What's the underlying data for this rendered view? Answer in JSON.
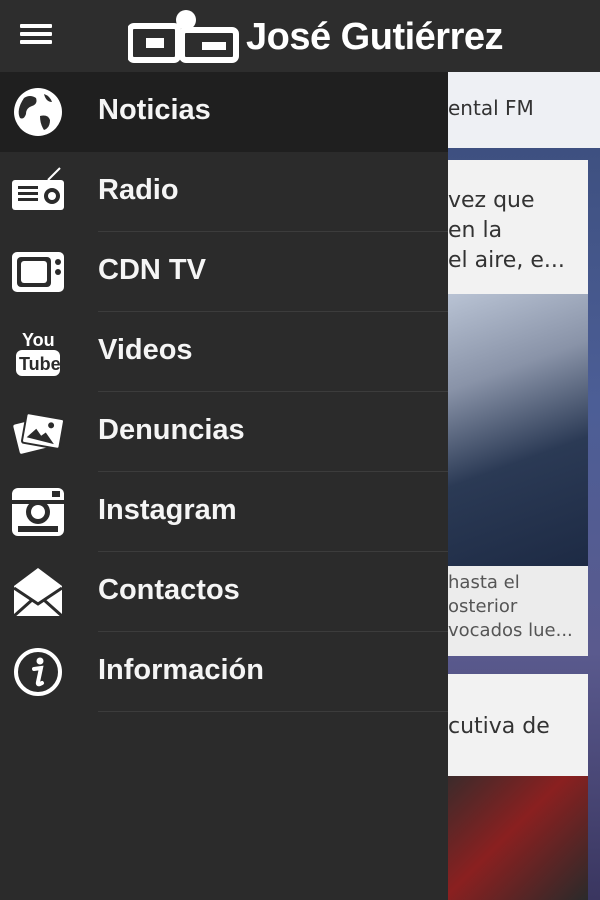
{
  "header": {
    "brand_title": "José Gutiérrez",
    "menu_icon": "hamburger-menu-icon",
    "logo_icon": "jg-logo-icon"
  },
  "drawer": {
    "items": [
      {
        "label": "Noticias",
        "icon": "globe-icon",
        "active": true
      },
      {
        "label": "Radio",
        "icon": "radio-icon",
        "active": false
      },
      {
        "label": "CDN TV",
        "icon": "tv-icon",
        "active": false
      },
      {
        "label": "Videos",
        "icon": "youtube-icon",
        "active": false
      },
      {
        "label": "Denuncias",
        "icon": "photos-icon",
        "active": false
      },
      {
        "label": "Instagram",
        "icon": "instagram-icon",
        "active": false
      },
      {
        "label": "Contactos",
        "icon": "envelope-icon",
        "active": false
      },
      {
        "label": "Información",
        "icon": "info-icon",
        "active": false
      }
    ]
  },
  "background_content": {
    "strip_text": "ental FM",
    "card1_lines": [
      "vez que",
      "en la",
      "el aire, e..."
    ],
    "card1_caption_lines": [
      "hasta el",
      "osterior",
      "vocados lue..."
    ],
    "card2_text": "cutiva de"
  },
  "colors": {
    "topbar": "#2d2d2d",
    "drawer": "#2b2b2b",
    "active_item": "#1f1f1f",
    "text": "#f5f5f5"
  }
}
